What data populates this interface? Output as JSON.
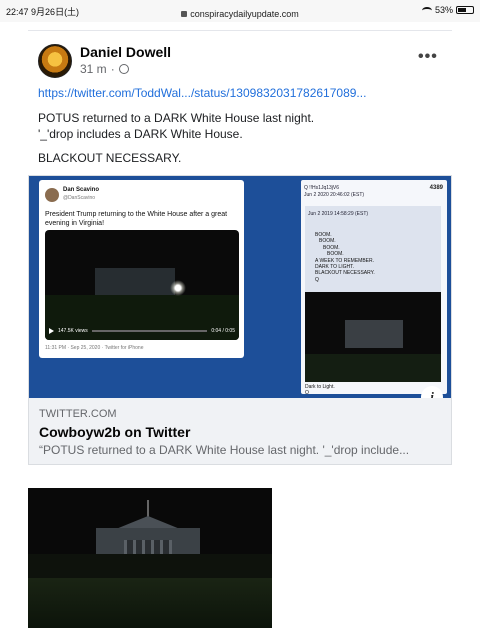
{
  "status_bar": {
    "time": "22:47",
    "date": "9月26日(土)",
    "url": "conspiracydailyupdate.com",
    "battery": "53%"
  },
  "post": {
    "author": "Daniel Dowell",
    "time_ago": "31 m",
    "more_label": "•••",
    "link": "https://twitter.com/ToddWal.../status/1309832031782617089...",
    "lines": [
      "POTUS returned to a DARK White House last night.",
      "'_'drop includes a DARK White House.",
      "BLACKOUT NECESSARY."
    ]
  },
  "preview": {
    "domain": "TWITTER.COM",
    "title": "Cowboyw2b on Twitter",
    "description": "“POTUS returned to a DARK White House last night. '_'drop include...",
    "info_label": "i",
    "tweet": {
      "name": "Dan Scavino",
      "handle": "@DanScavino",
      "text": "President Trump returning to the White House after a great evening in Virginia!",
      "views": "147.5K views",
      "duration": "0:04 / 0:05",
      "date": "11:31 PM · Sep 25, 2020 · Twitter for iPhone"
    },
    "qpost": {
      "header": "Q !!Hs1Jq13jV6",
      "date1": "Jun 2 2020 20:46:02 (EST)",
      "number": "4389",
      "date2": "Jun 2 2019 14:58:29 (EST)",
      "body": [
        "BOOM.",
        "BOOM.",
        "BOOM.",
        "BOOM.",
        "A WEEK TO REMEMBER.",
        "DARK TO LIGHT.",
        "BLACKOUT NECESSARY.",
        "Q"
      ],
      "caption": "Dark to Light.",
      "signoff": "Q"
    }
  },
  "colors": {
    "link": "#216fdb",
    "preview_bg": "#1d4f99",
    "arrow": "#e11b1b"
  }
}
